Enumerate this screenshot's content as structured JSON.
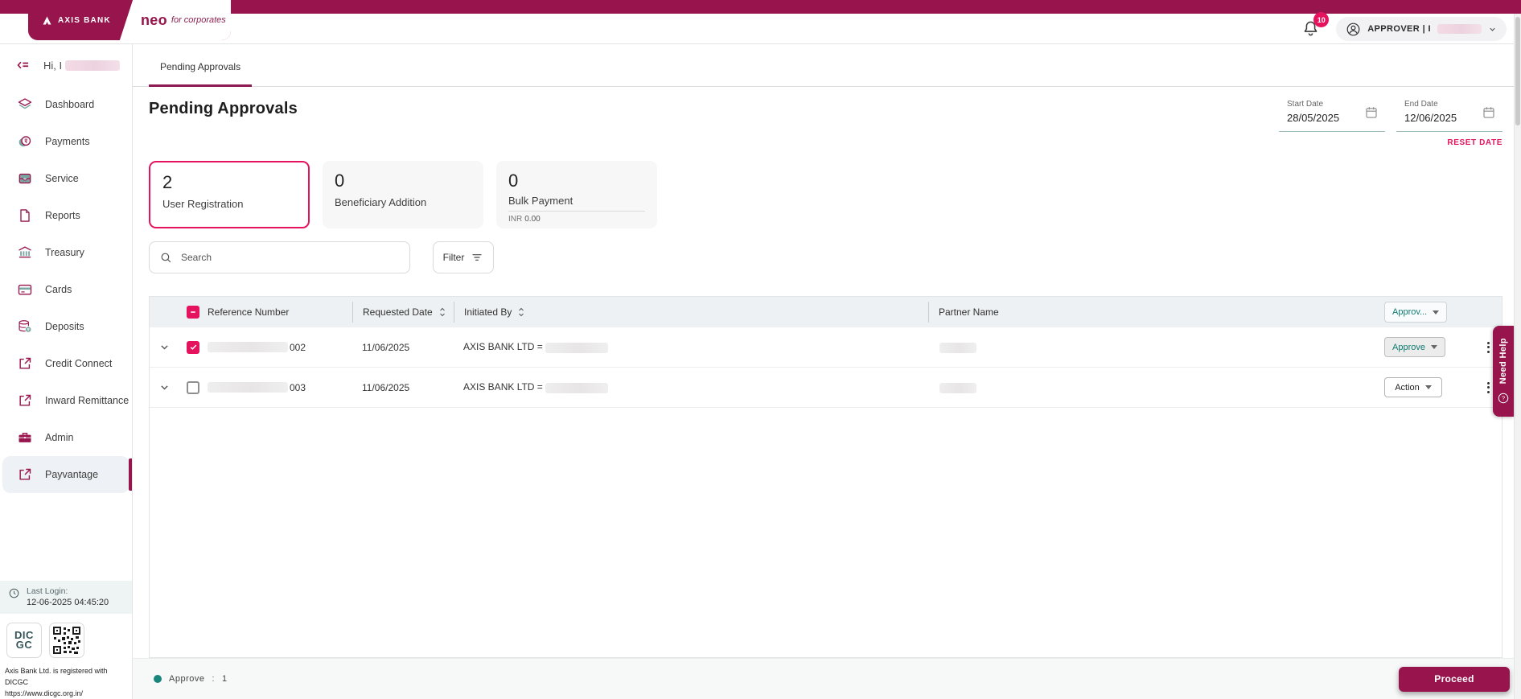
{
  "colors": {
    "brand_maroon": "#97144D",
    "accent_pink": "#E5135E",
    "teal_text": "#0F7C72",
    "icon_teal": "#7BA7A3"
  },
  "header": {
    "bank_name": "AXIS BANK",
    "product": "neo",
    "product_suffix": "for corporates",
    "notification_count": "10",
    "user_label": "APPROVER | I"
  },
  "sidebar": {
    "greeting": "Hi, I",
    "items": [
      {
        "label": "Dashboard",
        "icon": "layers-icon"
      },
      {
        "label": "Payments",
        "icon": "coins-icon"
      },
      {
        "label": "Service",
        "icon": "inbox-icon"
      },
      {
        "label": "Reports",
        "icon": "document-icon"
      },
      {
        "label": "Treasury",
        "icon": "bank-icon"
      },
      {
        "label": "Cards",
        "icon": "card-icon"
      },
      {
        "label": "Deposits",
        "icon": "deposits-icon"
      },
      {
        "label": "Credit Connect",
        "icon": "external-link-icon"
      },
      {
        "label": "Inward Remittance",
        "icon": "external-link-icon"
      },
      {
        "label": "Admin",
        "icon": "briefcase-icon"
      },
      {
        "label": "Payvantage",
        "icon": "external-link-icon",
        "active": true
      }
    ],
    "last_login_label": "Last Login:",
    "last_login_value": "12-06-2025  04:45:20",
    "dicgc_line1": "DIC",
    "dicgc_line2": "GC",
    "footer_line1": "Axis Bank Ltd. is registered with DICGC",
    "footer_line2": "https://www.dicgc.org.in/"
  },
  "tabs": [
    {
      "label": "Pending Approvals",
      "active": true
    }
  ],
  "page": {
    "title": "Pending Approvals",
    "start_date_label": "Start Date",
    "start_date_value": "28/05/2025",
    "end_date_label": "End Date",
    "end_date_value": "12/06/2025",
    "reset_label": "RESET DATE"
  },
  "summary_cards": [
    {
      "count": "2",
      "label": "User Registration",
      "selected": true
    },
    {
      "count": "0",
      "label": "Beneficiary Addition",
      "selected": false
    },
    {
      "count": "0",
      "label": "Bulk Payment",
      "sub_currency": "INR",
      "sub_amount": "0.00",
      "selected": false
    }
  ],
  "toolbar": {
    "search_placeholder": "Search",
    "filter_label": "Filter"
  },
  "table": {
    "columns": [
      {
        "label": "Reference Number",
        "sortable": false
      },
      {
        "label": "Requested Date",
        "sortable": true
      },
      {
        "label": "Initiated By",
        "sortable": true
      },
      {
        "label": "Partner Name",
        "sortable": false
      }
    ],
    "bulk_action_label": "Approv...",
    "rows": [
      {
        "checked": true,
        "reference_suffix": "002",
        "requested_date": "11/06/2025",
        "initiated_by_prefix": "AXIS BANK LTD =",
        "action_label": "Approve",
        "action_variant": "approve"
      },
      {
        "checked": false,
        "reference_suffix": "003",
        "requested_date": "11/06/2025",
        "initiated_by_prefix": "AXIS BANK LTD =",
        "action_label": "Action",
        "action_variant": "default"
      }
    ]
  },
  "footer": {
    "status_label": "Approve",
    "status_separator": ":",
    "status_count": "1",
    "proceed_label": "Proceed"
  },
  "help_tab": {
    "label": "Need Help"
  }
}
